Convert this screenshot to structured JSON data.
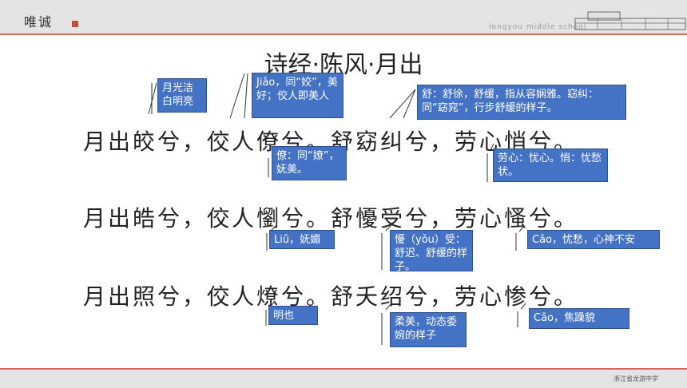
{
  "header": {
    "logo_text": "唯诚",
    "school_en": "longyou middle school"
  },
  "footer": {
    "school_cn": "浙江省龙游中学"
  },
  "title": "诗经·陈风·月出",
  "lines": [
    "月出皎兮，佼人僚兮。舒窈纠兮，劳心悄兮。",
    "月出皓兮，佼人懰兮。舒懮受兮，劳心慅兮。",
    "月出照兮，佼人燎兮。舒夭绍兮，劳心惨兮。"
  ],
  "notes": {
    "n1": "月光洁白明亮",
    "n2": "Jiǎo，同“姣”，美好；佼人即美人",
    "n3": "舒：舒徐，舒缓，指从容娴雅。窈纠：同“窈窕”，行步舒缓的样子。",
    "n4": "僚：同“嫽”，妩美。",
    "n5": "劳心：忧心。悄：忧愁状。",
    "n6": "Liǔ，妩媚",
    "n7": "懮（yǒu）受：舒迟、舒缓的样子。",
    "n8": "Cǎo，忧愁，心神不安",
    "n9": "明也",
    "n10": "柔美，动态委婉的样子",
    "n11": "Cǎo，焦躁貌"
  },
  "colors": {
    "note_bg": "#4472c4",
    "accent_line": "#cf6b57",
    "bar_bg": "#e4e4e4"
  }
}
